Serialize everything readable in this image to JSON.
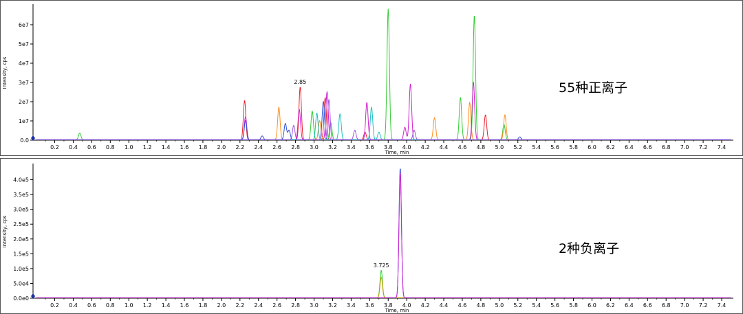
{
  "chart_data": [
    {
      "type": "line",
      "label": "55种正离子",
      "xlabel": "Time, min",
      "ylabel": "Intensity, cps",
      "xlim": [
        0,
        7.5
      ],
      "ylim": [
        0,
        70000000
      ],
      "x_ticks": [
        "0.2",
        "0.4",
        "0.6",
        "0.8",
        "1.0",
        "1.2",
        "1.4",
        "1.6",
        "1.8",
        "2.0",
        "2.2",
        "2.4",
        "2.6",
        "2.8",
        "3.0",
        "3.2",
        "3.4",
        "3.6",
        "3.8",
        "4.0",
        "4.2",
        "4.4",
        "4.6",
        "4.8",
        "5.0",
        "5.2",
        "5.4",
        "5.6",
        "5.8",
        "6.0",
        "6.2",
        "6.4",
        "6.6",
        "6.8",
        "7.0",
        "7.2",
        "7.4"
      ],
      "y_ticks": [
        {
          "value": 0,
          "label": "0.0"
        },
        {
          "value": 10000000,
          "label": "1e7"
        },
        {
          "value": 20000000,
          "label": "2e7"
        },
        {
          "value": 30000000,
          "label": "3e7"
        },
        {
          "value": 40000000,
          "label": "4e7"
        },
        {
          "value": 50000000,
          "label": "5e7"
        },
        {
          "value": 60000000,
          "label": "6e7"
        }
      ],
      "annotations": [
        {
          "x": 2.85,
          "text": "2.85"
        }
      ],
      "series": [
        {
          "color": "#e8202a",
          "peaks": [
            [
              2.25,
              20500000
            ],
            [
              2.85,
              27500000
            ],
            [
              3.12,
              22000000
            ],
            [
              3.55,
              4000000
            ],
            [
              4.85,
              13000000
            ]
          ]
        },
        {
          "color": "#32cd32",
          "peaks": [
            [
              0.47,
              3500000
            ],
            [
              2.98,
              15000000
            ],
            [
              3.18,
              9000000
            ],
            [
              3.8,
              68000000
            ],
            [
              4.58,
              22000000
            ],
            [
              4.73,
              65000000
            ],
            [
              5.05,
              8000000
            ]
          ]
        },
        {
          "color": "#ff8c1a",
          "peaks": [
            [
              2.62,
              17000000
            ],
            [
              3.06,
              10000000
            ],
            [
              4.3,
              11500000
            ],
            [
              4.68,
              19500000
            ],
            [
              5.06,
              13000000
            ]
          ]
        },
        {
          "color": "#d020d0",
          "peaks": [
            [
              2.26,
              12000000
            ],
            [
              2.84,
              16000000
            ],
            [
              3.14,
              25000000
            ],
            [
              3.57,
              19500000
            ],
            [
              3.98,
              6500000
            ],
            [
              4.04,
              29000000
            ],
            [
              4.72,
              30000000
            ]
          ]
        },
        {
          "color": "#2e4fd6",
          "peaks": [
            [
              2.26,
              10000000
            ],
            [
              2.44,
              2000000
            ],
            [
              2.69,
              8500000
            ],
            [
              2.73,
              5000000
            ],
            [
              3.1,
              20000000
            ],
            [
              5.22,
              1500000
            ]
          ]
        },
        {
          "color": "#19c2c2",
          "peaks": [
            [
              3.03,
              14000000
            ],
            [
              3.28,
              13500000
            ],
            [
              3.62,
              17000000
            ],
            [
              3.7,
              4000000
            ]
          ]
        },
        {
          "color": "#a050e0",
          "peaks": [
            [
              3.16,
              21000000
            ],
            [
              3.44,
              5000000
            ],
            [
              2.78,
              7500000
            ],
            [
              4.08,
              5000000
            ]
          ]
        }
      ]
    },
    {
      "type": "line",
      "label": "2种负离子",
      "xlabel": "Time, min",
      "ylabel": "Intensity, cps",
      "xlim": [
        0,
        7.5
      ],
      "ylim": [
        0,
        450000
      ],
      "x_ticks": [
        "0.2",
        "0.4",
        "0.6",
        "0.8",
        "1.0",
        "1.2",
        "1.4",
        "1.6",
        "1.8",
        "2.0",
        "2.2",
        "2.4",
        "2.6",
        "2.8",
        "3.0",
        "3.2",
        "3.4",
        "3.6",
        "3.8",
        "4.0",
        "4.2",
        "4.4",
        "4.6",
        "4.8",
        "5.0",
        "5.2",
        "5.4",
        "5.6",
        "5.8",
        "6.0",
        "6.2",
        "6.4",
        "6.6",
        "6.8",
        "7.0",
        "7.2",
        "7.4"
      ],
      "y_ticks": [
        {
          "value": 0,
          "label": "0.0e0"
        },
        {
          "value": 50000,
          "label": "5.0e4"
        },
        {
          "value": 100000,
          "label": "1.0e5"
        },
        {
          "value": 150000,
          "label": "1.5e5"
        },
        {
          "value": 200000,
          "label": "2.0e5"
        },
        {
          "value": 250000,
          "label": "2.5e5"
        },
        {
          "value": 300000,
          "label": "3.0e5"
        },
        {
          "value": 350000,
          "label": "3.5e5"
        },
        {
          "value": 400000,
          "label": "4.0e5"
        }
      ],
      "annotations": [
        {
          "x": 3.725,
          "text": "3.725"
        }
      ],
      "series": [
        {
          "color": "#32cd32",
          "peaks": [
            [
              3.725,
              93000
            ]
          ]
        },
        {
          "color": "#c8a000",
          "peaks": [
            [
              3.725,
              70000
            ]
          ]
        },
        {
          "color": "#2e4fd6",
          "peaks": [
            [
              3.93,
              440000
            ]
          ]
        },
        {
          "color": "#d020d0",
          "peaks": [
            [
              3.93,
              425000
            ]
          ]
        }
      ]
    }
  ]
}
